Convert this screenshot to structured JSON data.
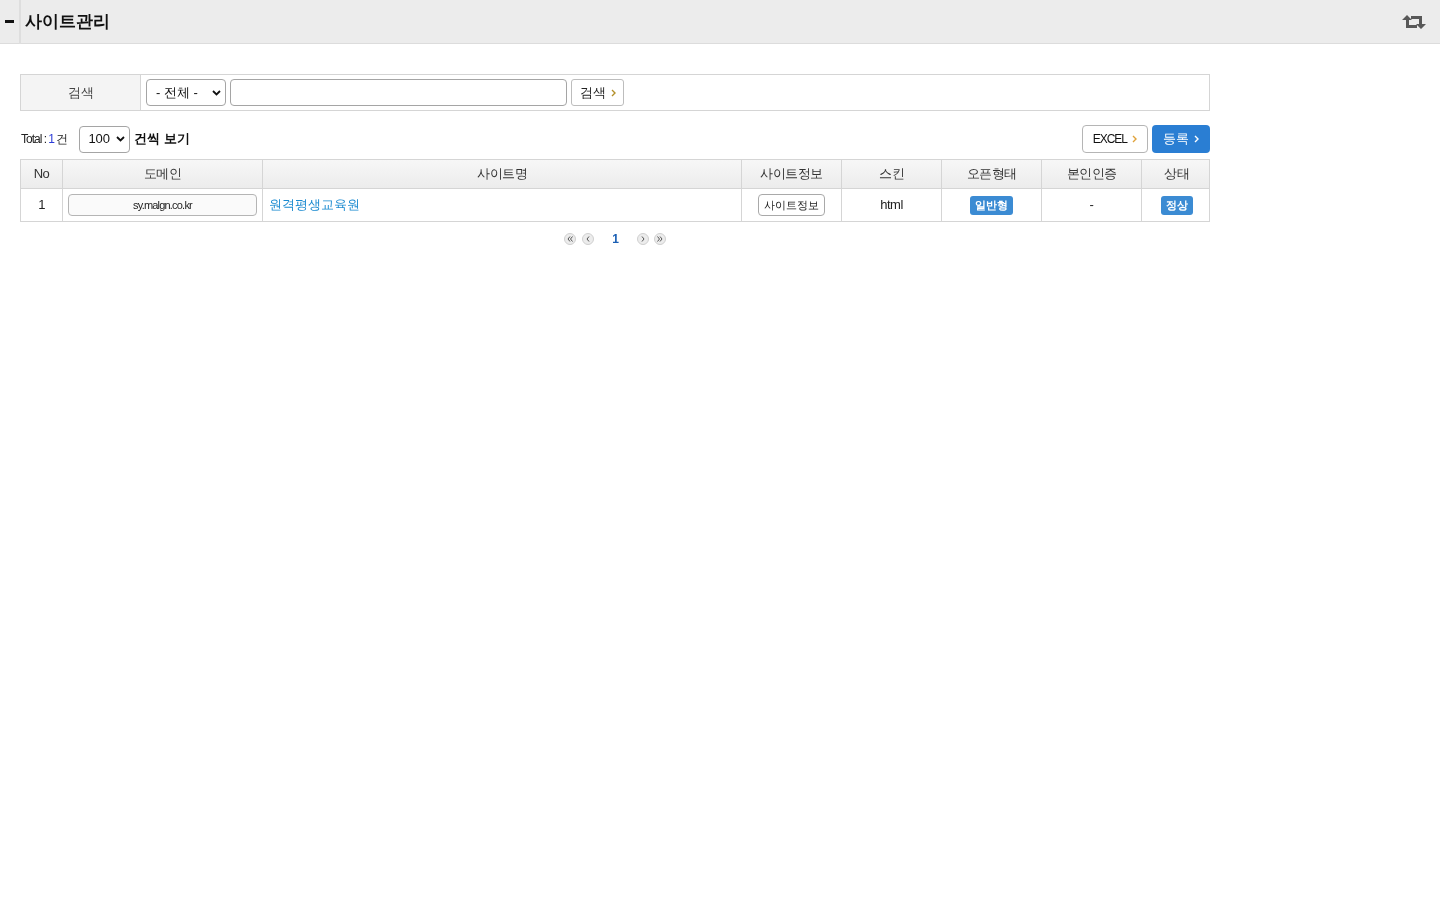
{
  "header": {
    "title": "사이트관리"
  },
  "search": {
    "label": "검색",
    "scope": "- 전체 -",
    "button": "검색"
  },
  "list_bar": {
    "total_label": "Total :",
    "total_count": "1",
    "total_unit": "건",
    "page_size": "100",
    "page_size_label": "건씩 보기",
    "buttons": [
      {
        "label": "EXCEL",
        "kind": "outline"
      },
      {
        "label": "등록",
        "kind": "primary"
      }
    ]
  },
  "table": {
    "columns": [
      "No",
      "도메인",
      "사이트명",
      "사이트정보",
      "스킨",
      "오픈형태",
      "본인인증",
      "상태"
    ],
    "rows": [
      {
        "cells": [
          {
            "kind": "text",
            "text": "1"
          },
          {
            "kind": "field",
            "text": "sy.malgn.co.kr"
          },
          {
            "kind": "link",
            "text": "원격평생교육원"
          },
          {
            "kind": "button",
            "text": "사이트정보"
          },
          {
            "kind": "text",
            "text": "html"
          },
          {
            "kind": "badge",
            "text": "일반형"
          },
          {
            "kind": "text",
            "text": "-"
          },
          {
            "kind": "badge",
            "text": "정상"
          }
        ]
      }
    ]
  },
  "pagination": {
    "pages": [
      {
        "label": "1",
        "selected": true
      }
    ]
  }
}
